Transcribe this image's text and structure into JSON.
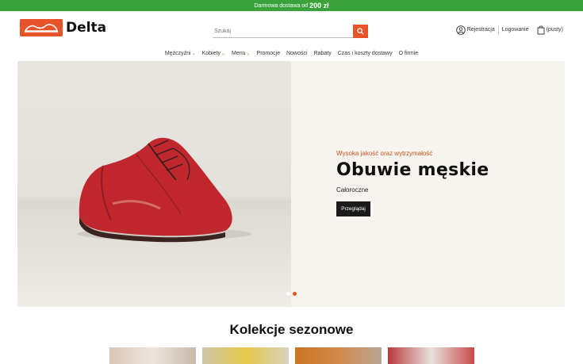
{
  "topbar": {
    "text": "Darmowa dostawa od",
    "amount": "200 zł"
  },
  "logo": {
    "text": "Delta"
  },
  "search": {
    "placeholder": "Szukaj"
  },
  "account": {
    "register": "Rejestracja",
    "login": "Logowanie",
    "cart": "(pusty)"
  },
  "nav": [
    {
      "label": "Mężczyźni",
      "dropdown": true
    },
    {
      "label": "Kobiety",
      "dropdown": true
    },
    {
      "label": "Menu",
      "dropdown": true
    },
    {
      "label": "Promocje",
      "dropdown": false
    },
    {
      "label": "Nowości",
      "dropdown": false
    },
    {
      "label": "Rabaty",
      "dropdown": false
    },
    {
      "label": "Czas i koszty dostawy",
      "dropdown": false
    },
    {
      "label": "O firmie",
      "dropdown": false
    }
  ],
  "hero": {
    "subtitle": "Wysoka jakość oraz wytrzymałość",
    "title": "Obuwie męskie",
    "caption": "Całoroczne",
    "button": "Przeglądaj",
    "slides": 2,
    "active_slide": 2
  },
  "collections": {
    "title": "Kolekcje sezonowe"
  },
  "colors": {
    "accent": "#e8532a",
    "topbar": "#3aa23a",
    "dark": "#1a1a1a"
  }
}
